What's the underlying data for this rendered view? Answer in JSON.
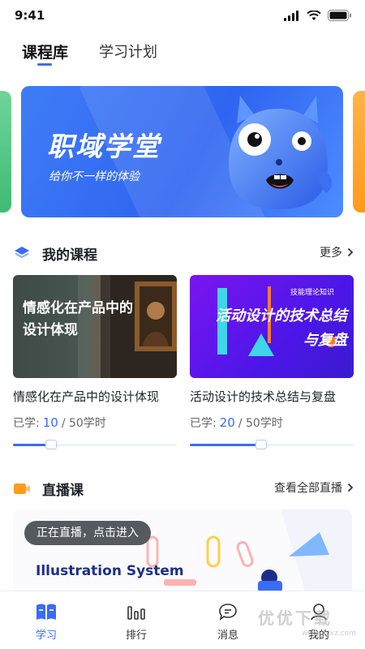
{
  "status": {
    "time": "9:41"
  },
  "tabs": [
    {
      "label": "课程库",
      "active": true
    },
    {
      "label": "学习计划",
      "active": false
    }
  ],
  "banner": {
    "title": "职域学堂",
    "subtitle": "给你不一样的体验"
  },
  "my_courses": {
    "title": "我的课程",
    "more_label": "更多",
    "items": [
      {
        "thumb_text": "情感化在产品中的设计体现",
        "name": "情感化在产品中的设计体现",
        "learned_label": "已学:",
        "learned": "10",
        "total": "50学时",
        "progress": 0.2
      },
      {
        "thumb_small": "技能理论知识",
        "thumb_text": "活动设计的技术总结与复盘",
        "name": "活动设计的技术总结与复盘",
        "learned_label": "已学:",
        "learned": "20",
        "total": "50学时",
        "progress": 0.4
      }
    ]
  },
  "live": {
    "title": "直播课",
    "more_label": "查看全部直播",
    "pill": "正在直播，点击进入",
    "art_text": "Illustration System"
  },
  "tabbar": [
    {
      "label": "学习",
      "icon": "book-icon",
      "active": true
    },
    {
      "label": "排行",
      "icon": "ranking-icon",
      "active": false
    },
    {
      "label": "消息",
      "icon": "message-icon",
      "active": false
    },
    {
      "label": "我的",
      "icon": "profile-icon",
      "active": false
    }
  ],
  "watermark": {
    "text": "优优下载",
    "url": "www.yyxz.com"
  },
  "colors": {
    "accent": "#3a6cf4",
    "banner": "#3f7df7",
    "live_icon": "#ff9d1e"
  }
}
